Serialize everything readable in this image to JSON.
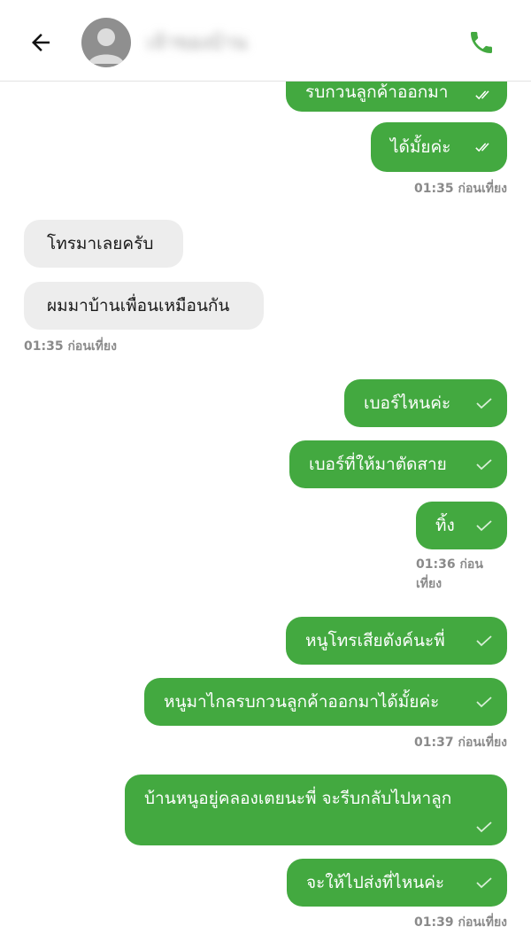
{
  "header": {
    "contact_name": "เจ้าของบ้าน",
    "back_icon": "arrow-left-icon",
    "call_icon": "phone-icon",
    "avatar_icon": "person-icon",
    "accent": "#43a940"
  },
  "messages": {
    "m0": {
      "text": "รบกวนลูกค้าออกมา",
      "status": "read"
    },
    "m1": {
      "text": "ได้มั้ยค่ะ",
      "status": "read"
    },
    "t1": "01:35 ก่อนเที่ยง",
    "m2": {
      "text": "โทรมาเลยครับ"
    },
    "m3": {
      "text": "ผมมาบ้านเพื่อนเหมือนกัน"
    },
    "t2": "01:35 ก่อนเที่ยง",
    "m4": {
      "text": "เบอร์ไหนค่ะ",
      "status": "sent"
    },
    "m5": {
      "text": "เบอร์ที่ให้มาตัดสาย",
      "status": "sent"
    },
    "m6": {
      "text": "ทิ้ง",
      "status": "sent"
    },
    "t3": "01:36 ก่อน เที่ยง",
    "m7": {
      "text": "หนูโทรเสียตังค์นะพี่",
      "status": "sent"
    },
    "m8": {
      "text": "หนูมาไกลรบกวนลูกค้าออกมาได้มั้ยค่ะ",
      "status": "sent"
    },
    "t4": "01:37 ก่อนเที่ยง",
    "m9": {
      "text": "บ้านหนูอยู่คลองเตยนะพี่ จะรีบกลับไปหาลูก",
      "status": "sent"
    },
    "m10": {
      "text": "จะให้ไปส่งที่ไหนค่ะ",
      "status": "sent"
    },
    "t5": "01:39 ก่อนเที่ยง"
  }
}
